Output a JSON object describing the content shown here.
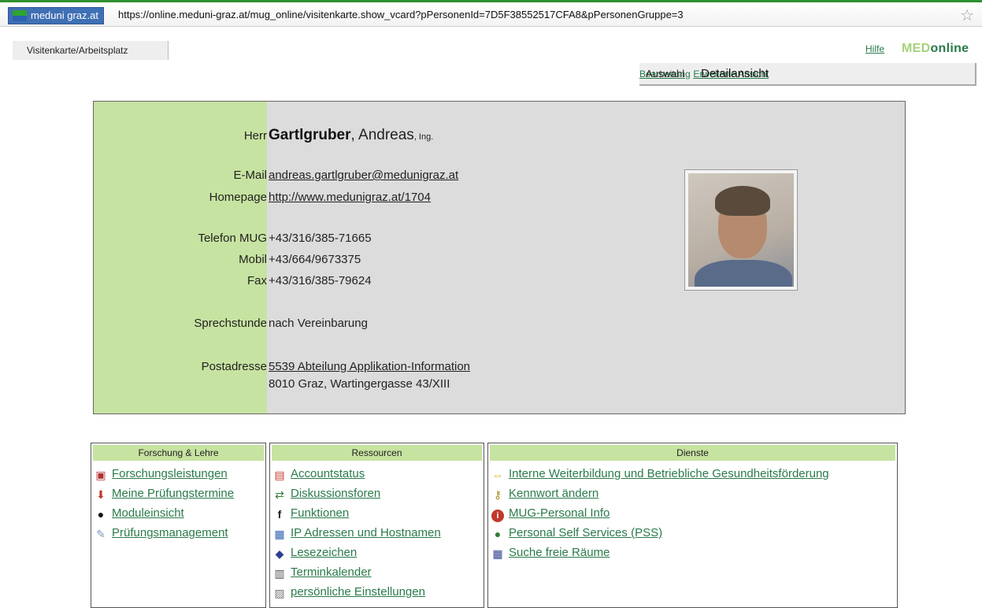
{
  "browser": {
    "site_identity": "meduni graz.at",
    "url": "https://online.meduni-graz.at/mug_online/visitenkarte.show_vcard?pPersonenId=7D5F38552517CFA8&pPersonenGruppe=3"
  },
  "header": {
    "tab_label": "Visitenkarte/Arbeitsplatz",
    "help_link": "Hilfe",
    "brand_med": "MED",
    "brand_online": "online",
    "views": {
      "auswahl": "Auswahl",
      "detail": "Detailansicht",
      "bearbeitung": "Bearbeitung",
      "erweitert": "Erweiterte Ansicht"
    }
  },
  "card": {
    "salutation": "Herr",
    "last_name": "Gartlgruber",
    "first_name": ", Andreas",
    "title": ", Ing.",
    "email_label": "E-Mail",
    "email": "andreas.gartlgruber@medunigraz.at",
    "homepage_label": "Homepage",
    "homepage": "http://www.medunigraz.at/1704",
    "phone_label": "Telefon  MUG",
    "phone": "+43/316/385-71665",
    "mobile_label": "Mobil",
    "mobile": "+43/664/9673375",
    "fax_label": "Fax",
    "fax": "+43/316/385-79624",
    "office_hours_label": "Sprechstunde",
    "office_hours": "nach Vereinbarung",
    "address_label": "Postadresse",
    "address_org": "5539 Abteilung Applikation-Information",
    "address_street": "8010 Graz, Wartingergasse 43/XIII"
  },
  "panels": {
    "forschung": {
      "header": "Forschung & Lehre",
      "items": [
        "Forschungsleistungen",
        "Meine Prüfungstermine",
        "Moduleinsicht",
        "Prüfungsmanagement"
      ]
    },
    "ressourcen": {
      "header": "Ressourcen",
      "items": [
        "Accountstatus",
        "Diskussionsforen",
        "Funktionen",
        "IP Adressen und Hostnamen",
        "Lesezeichen",
        "Terminkalender",
        "persönliche Einstellungen"
      ]
    },
    "dienste": {
      "header": "Dienste",
      "items": [
        "Interne Weiterbildung und Betriebliche Gesundheitsförderung",
        "Kennwort ändern",
        "MUG-Personal Info",
        "Personal Self Services (PSS)",
        "Suche freie Räume"
      ]
    }
  }
}
